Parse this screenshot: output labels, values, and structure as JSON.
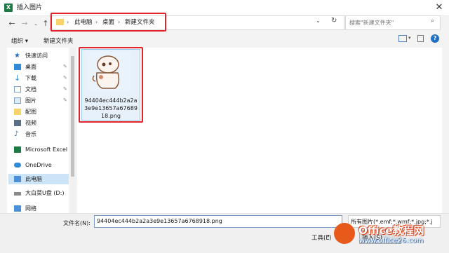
{
  "window": {
    "title": "插入图片",
    "close_glyph": "✕"
  },
  "address_bar": {
    "crumbs": [
      "此电脑",
      "桌面",
      "新建文件夹"
    ],
    "search_placeholder": "搜索\"新建文件夹\""
  },
  "toolbar": {
    "organize_label": "组织 ▾",
    "new_folder_label": "新建文件夹"
  },
  "nav": [
    {
      "label": "快速访问",
      "icon": "star-icon",
      "pinned": false
    },
    {
      "label": "桌面",
      "icon": "desktop-icon",
      "pinned": true
    },
    {
      "label": "下载",
      "icon": "download-icon",
      "pinned": true
    },
    {
      "label": "文档",
      "icon": "document-icon",
      "pinned": true
    },
    {
      "label": "图片",
      "icon": "pictures-icon",
      "pinned": true
    },
    {
      "label": "配图",
      "icon": "folder-icon",
      "pinned": false
    },
    {
      "label": "视频",
      "icon": "video-icon",
      "pinned": false
    },
    {
      "label": "音乐",
      "icon": "music-icon",
      "pinned": false
    },
    {
      "label": "Microsoft Excel",
      "icon": "excel-icon",
      "pinned": false
    },
    {
      "label": "OneDrive",
      "icon": "cloud-icon",
      "pinned": false
    },
    {
      "label": "此电脑",
      "icon": "computer-icon",
      "pinned": false
    },
    {
      "label": "大白菜U盘 (D:)",
      "icon": "usb-drive-icon",
      "pinned": false
    },
    {
      "label": "网络",
      "icon": "network-icon",
      "pinned": false
    }
  ],
  "file": {
    "name": "94404ec444b2a2a3e9e13657a6768918.png"
  },
  "bottom": {
    "filename_label": "文件名(N):",
    "filename_value": "94404ec444b2a2a3e9e13657a6768918.png",
    "filetype_value": "所有图片(*.emf;*.wmf;*.jpg;*.j",
    "tools_label": "工具(L)",
    "insert_label": "插入(S)"
  },
  "watermark": {
    "text": "Office教程网",
    "sub": "www.office26.com"
  },
  "colors": {
    "highlight": "#e2232a",
    "selection": "#cce4f7",
    "excel_green": "#1d7a44"
  }
}
